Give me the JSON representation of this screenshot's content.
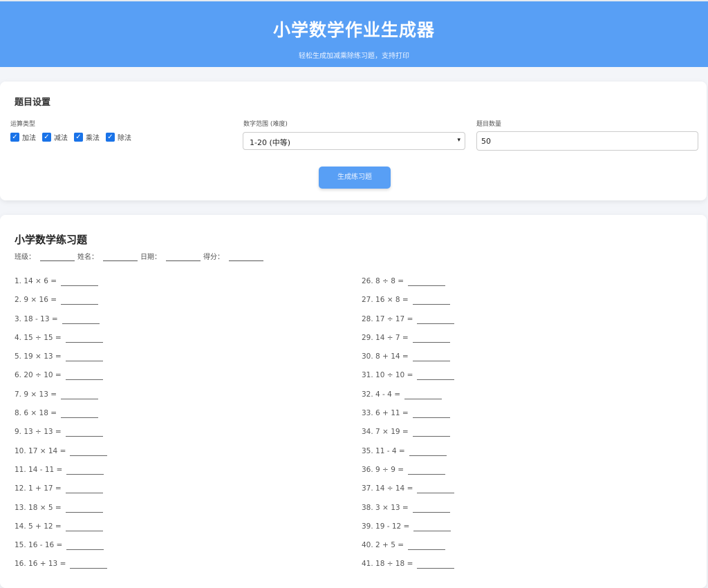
{
  "header": {
    "title": "小学数学作业生成器",
    "subtitle": "轻松生成加减乘除练习题，支持打印"
  },
  "settings": {
    "title": "题目设置",
    "op_label": "运算类型",
    "ops": [
      {
        "label": "加法",
        "checked": true
      },
      {
        "label": "减法",
        "checked": true
      },
      {
        "label": "乘法",
        "checked": true
      },
      {
        "label": "除法",
        "checked": true
      }
    ],
    "range_label": "数字范围 (难度)",
    "range_value": "1-20 (中等)",
    "count_label": "题目数量",
    "count_value": "50",
    "generate_label": "生成练习题"
  },
  "worksheet": {
    "title": "小学数学练习题",
    "fields": [
      "班级：",
      "姓名：",
      "日期：",
      "得分："
    ],
    "left": [
      "1. 14 × 6 =",
      "2. 9 × 16 =",
      "3. 18 - 13 =",
      "4. 15 ÷ 15 =",
      "5. 19 × 13 =",
      "6. 20 ÷ 10 =",
      "7. 9 × 13 =",
      "8. 6 × 18 =",
      "9. 13 ÷ 13 =",
      "10. 17 × 14 =",
      "11. 14 - 11 =",
      "12. 1 + 17 =",
      "13. 18 × 5 =",
      "14. 5 + 12 =",
      "15. 16 - 16 =",
      "16. 16 + 13 ="
    ],
    "right": [
      "26. 8 ÷ 8 =",
      "27. 16 × 8 =",
      "28. 17 ÷ 17 =",
      "29. 14 ÷ 7 =",
      "30. 8 + 14 =",
      "31. 10 ÷ 10 =",
      "32. 4 - 4 =",
      "33. 6 + 11 =",
      "34. 7 × 19 =",
      "35. 11 - 4 =",
      "36. 9 ÷ 9 =",
      "37. 14 ÷ 14 =",
      "38. 3 × 13 =",
      "39. 19 - 12 =",
      "40. 2 + 5 =",
      "41. 18 ÷ 18 ="
    ]
  }
}
